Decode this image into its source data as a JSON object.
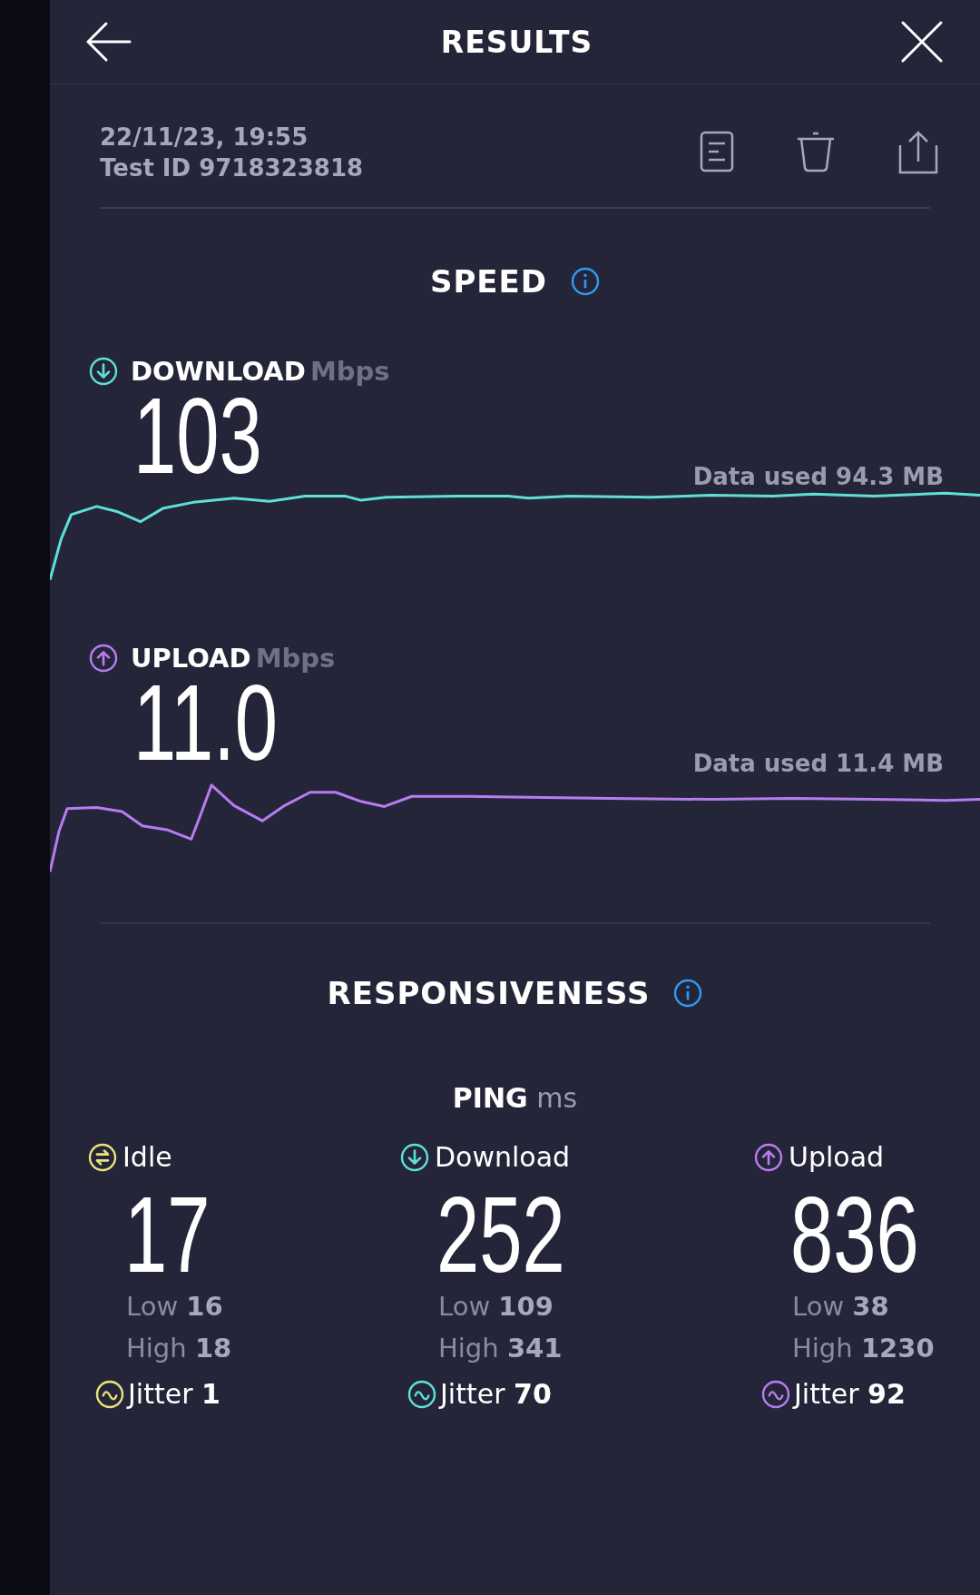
{
  "header": {
    "title": "RESULTS"
  },
  "test": {
    "date": "22/11/23, 19:55",
    "test_id": "Test ID 9718323818"
  },
  "speed": {
    "title": "SPEED",
    "metrics": [
      {
        "kind": "download",
        "label": "DOWNLOAD",
        "unit": "Mbps",
        "value": "103",
        "data_used": "Data used 94.3 MB",
        "color": "#5ee0d8"
      },
      {
        "kind": "upload",
        "label": "UPLOAD",
        "unit": "Mbps",
        "value": "11.0",
        "data_used": "Data used 11.4 MB",
        "color": "#b67cf0"
      }
    ]
  },
  "responsiveness": {
    "title": "RESPONSIVENESS",
    "ping_label": "PING",
    "ping_unit": "ms",
    "columns": [
      {
        "kind": "idle",
        "label": "Idle",
        "value": "17",
        "low": "Low **16**",
        "high": "High **18**",
        "jitter": "Jitter **1**",
        "color": "#ebe27a"
      },
      {
        "kind": "download",
        "label": "Download",
        "value": "252",
        "low": "Low **109**",
        "high": "High **341**",
        "jitter": "Jitter **70**",
        "color": "#5ee0d8"
      },
      {
        "kind": "upload",
        "label": "Upload",
        "value": "836",
        "low": "Low **38**",
        "high": "High **1230**",
        "jitter": "Jitter **92**",
        "color": "#b67cf0"
      }
    ]
  }
}
